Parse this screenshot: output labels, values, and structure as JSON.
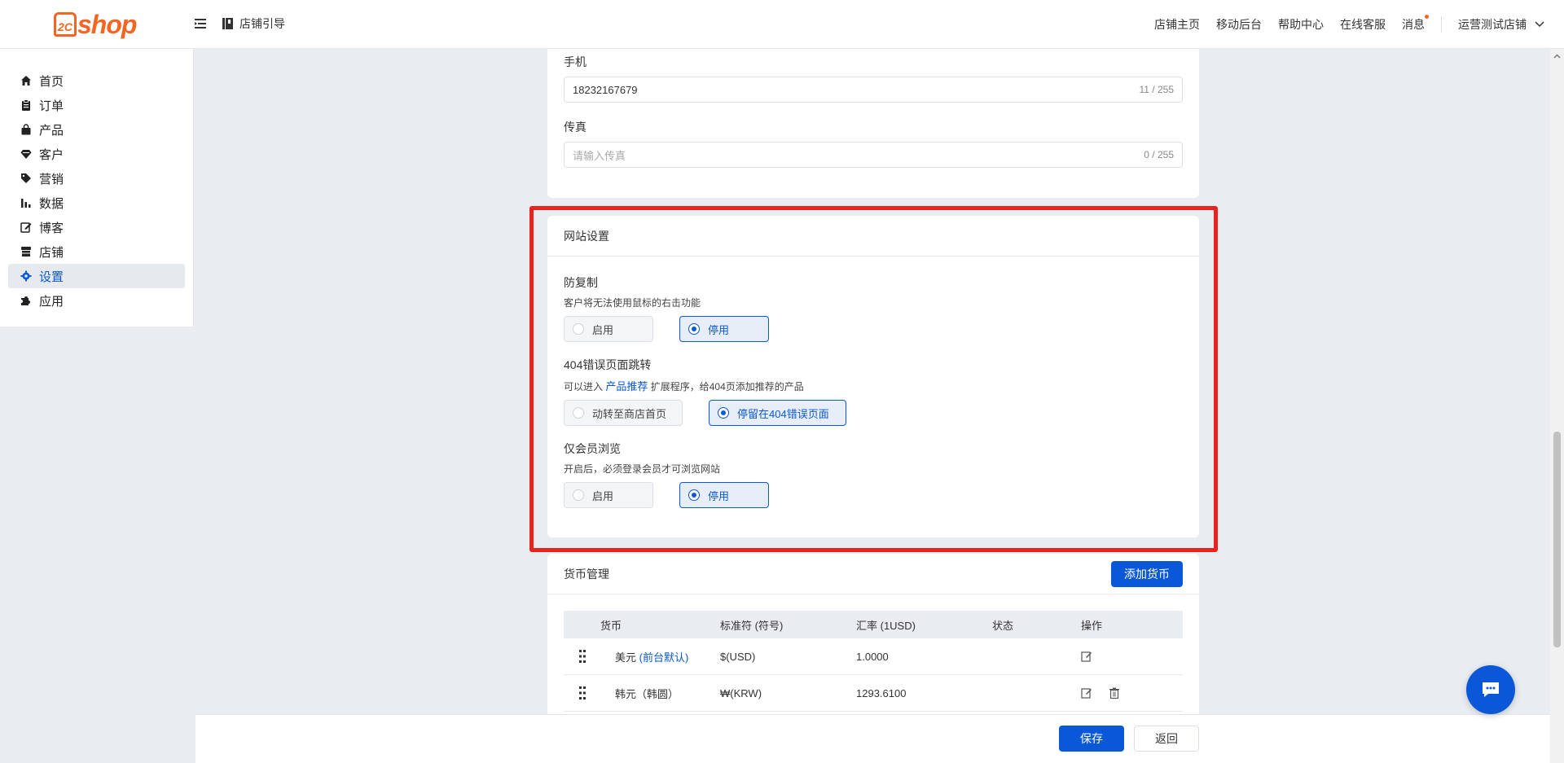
{
  "header": {
    "logo_prefix": "2C",
    "logo_text": "shop",
    "guide_label": "店铺引导",
    "nav": [
      "店铺主页",
      "移动后台",
      "帮助中心",
      "在线客服",
      "消息"
    ],
    "store_name": "运营测试店铺"
  },
  "sidebar": {
    "items": [
      {
        "label": "首页",
        "icon": "home-icon"
      },
      {
        "label": "订单",
        "icon": "clipboard-icon"
      },
      {
        "label": "产品",
        "icon": "bag-icon"
      },
      {
        "label": "客户",
        "icon": "diamond-icon"
      },
      {
        "label": "营销",
        "icon": "tag-icon"
      },
      {
        "label": "数据",
        "icon": "bar-chart-icon"
      },
      {
        "label": "博客",
        "icon": "edit-icon"
      },
      {
        "label": "店铺",
        "icon": "store-icon"
      },
      {
        "label": "设置",
        "icon": "gear-icon",
        "active": true
      },
      {
        "label": "应用",
        "icon": "puzzle-icon"
      }
    ]
  },
  "contact": {
    "phone_label": "手机",
    "phone_value": "18232167679",
    "phone_counter": "11 / 255",
    "fax_label": "传真",
    "fax_placeholder": "请输入传真",
    "fax_counter": "0 / 255"
  },
  "website_settings": {
    "title": "网站设置",
    "anti_copy": {
      "title": "防复制",
      "desc": "客户将无法使用鼠标的右击功能",
      "options": [
        "启用",
        "停用"
      ],
      "selected": "停用"
    },
    "redirect_404": {
      "title": "404错误页面跳转",
      "desc_prefix": "可以进入",
      "desc_link": "产品推荐",
      "desc_suffix": "扩展程序，给404页添加推荐的产品",
      "options": [
        "动转至商店首页",
        "停留在404错误页面"
      ],
      "selected": "停留在404错误页面"
    },
    "members_only": {
      "title": "仅会员浏览",
      "desc": "开启后，必须登录会员才可浏览网站",
      "options": [
        "启用",
        "停用"
      ],
      "selected": "停用"
    }
  },
  "currency": {
    "title": "货币管理",
    "add_button": "添加货币",
    "columns": [
      "货币",
      "标准符 (符号)",
      "汇率 (1USD)",
      "状态",
      "操作"
    ],
    "rows": [
      {
        "name": "美元",
        "tag": "(前台默认)",
        "code": "$(USD)",
        "rate": "1.0000",
        "enabled": true
      },
      {
        "name": "韩元（韩圆）",
        "tag": "",
        "code": "₩(KRW)",
        "rate": "1293.6100",
        "enabled": true
      }
    ]
  },
  "footer": {
    "save": "保存",
    "back": "返回"
  },
  "colors": {
    "accent": "#0a58d8",
    "brand": "#f26522",
    "highlight": "#e8231d"
  }
}
